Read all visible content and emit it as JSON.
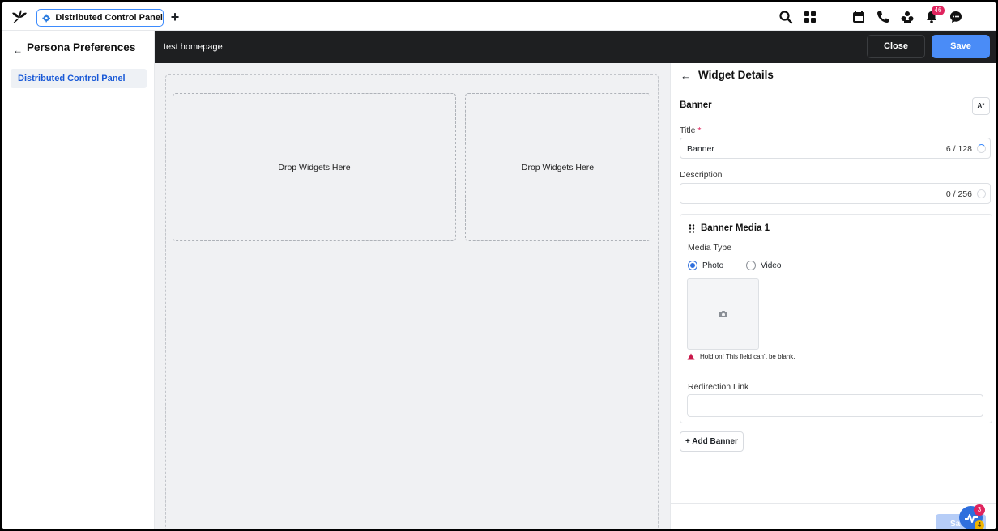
{
  "topbar": {
    "tab_label": "Distributed Control Panel",
    "notification_count": "46",
    "icons": [
      "search-icon",
      "apps-grid-icon",
      "calendar-icon",
      "phone-icon",
      "community-icon",
      "bell-icon",
      "chat-icon"
    ]
  },
  "sidebar": {
    "title": "Persona Preferences",
    "items": [
      {
        "label": "Distributed Control Panel",
        "active": true
      }
    ]
  },
  "editor": {
    "page_name": "test homepage",
    "close_label": "Close",
    "save_label": "Save",
    "drop_zones": [
      "Drop Widgets Here",
      "Drop Widgets Here"
    ]
  },
  "widget_details": {
    "heading": "Widget Details",
    "widget_type": "Banner",
    "ai_button": "A*",
    "title_label": "Title",
    "required_mark": "*",
    "title_value": "Banner",
    "title_count": "6 / 128",
    "description_label": "Description",
    "description_value": "",
    "description_count": "0 / 256",
    "media": {
      "heading": "Banner Media 1",
      "media_type_label": "Media Type",
      "options": [
        "Photo",
        "Video"
      ],
      "selected": "Photo",
      "error": "Hold on! This field can't be blank.",
      "redirection_label": "Redirection Link",
      "redirection_value": ""
    },
    "add_banner_label": "+ Add Banner",
    "footer_save_label": "Sa"
  },
  "fab": {
    "badge_top": "3",
    "badge_bottom": "4"
  },
  "colors": {
    "accent": "#4a8cf7",
    "dark_header": "#1e1f21",
    "error": "#e0245e",
    "active_nav": "#1a5ad7"
  }
}
